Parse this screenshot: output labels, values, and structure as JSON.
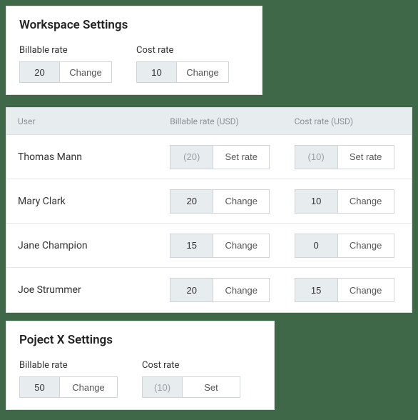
{
  "workspace": {
    "title": "Workspace Settings",
    "billable": {
      "label": "Billable rate",
      "value": "20",
      "button": "Change",
      "placeholder": false
    },
    "cost": {
      "label": "Cost rate",
      "value": "10",
      "button": "Change",
      "placeholder": false
    }
  },
  "table": {
    "headers": {
      "user": "User",
      "billable": "Billable rate (USD)",
      "cost": "Cost rate (USD)"
    },
    "rows": [
      {
        "user": "Thomas Mann",
        "billable": {
          "value": "(20)",
          "button": "Set rate",
          "placeholder": true
        },
        "cost": {
          "value": "(10)",
          "button": "Set rate",
          "placeholder": true
        }
      },
      {
        "user": "Mary Clark",
        "billable": {
          "value": "20",
          "button": "Change",
          "placeholder": false
        },
        "cost": {
          "value": "10",
          "button": "Change",
          "placeholder": false
        }
      },
      {
        "user": "Jane Champion",
        "billable": {
          "value": "15",
          "button": "Change",
          "placeholder": false
        },
        "cost": {
          "value": "0",
          "button": "Change",
          "placeholder": false
        }
      },
      {
        "user": "Joe Strummer",
        "billable": {
          "value": "20",
          "button": "Change",
          "placeholder": false
        },
        "cost": {
          "value": "15",
          "button": "Change",
          "placeholder": false
        }
      }
    ]
  },
  "project": {
    "title": "Poject X Settings",
    "billable": {
      "label": "Billable rate",
      "value": "50",
      "button": "Change",
      "placeholder": false
    },
    "cost": {
      "label": "Cost rate",
      "value": "(10)",
      "button": "Set",
      "placeholder": true
    }
  }
}
